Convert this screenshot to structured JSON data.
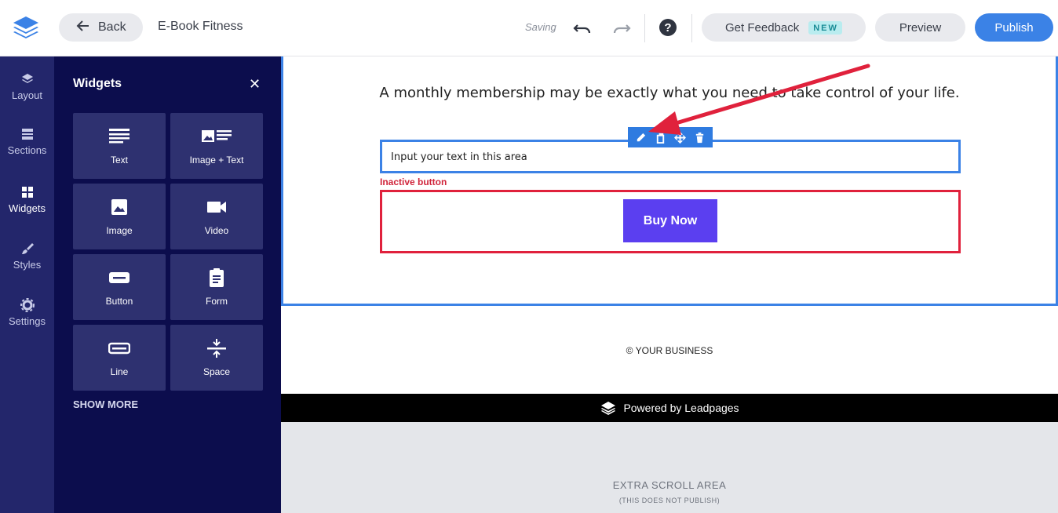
{
  "topbar": {
    "back_label": "Back",
    "page_name": "E-Book Fitness",
    "status": "Saving",
    "feedback_label": "Get Feedback",
    "feedback_badge": "NEW",
    "preview_label": "Preview",
    "publish_label": "Publish"
  },
  "rail": {
    "items": [
      {
        "label": "Layout",
        "icon": "layers-icon"
      },
      {
        "label": "Sections",
        "icon": "sections-icon"
      },
      {
        "label": "Widgets",
        "icon": "widgets-icon",
        "active": true
      },
      {
        "label": "Styles",
        "icon": "brush-icon"
      },
      {
        "label": "Settings",
        "icon": "gear-icon"
      }
    ]
  },
  "panel": {
    "title": "Widgets",
    "tiles": [
      {
        "label": "Text",
        "icon": "text-icon"
      },
      {
        "label": "Image + Text",
        "icon": "image-text-icon"
      },
      {
        "label": "Image",
        "icon": "image-icon"
      },
      {
        "label": "Video",
        "icon": "video-icon"
      },
      {
        "label": "Button",
        "icon": "button-icon"
      },
      {
        "label": "Form",
        "icon": "form-icon"
      },
      {
        "label": "Line",
        "icon": "line-icon"
      },
      {
        "label": "Space",
        "icon": "space-icon"
      }
    ],
    "show_more": "SHOW MORE"
  },
  "canvas": {
    "headline": "A monthly membership may be exactly what you need to take control of your life.",
    "text_widget": "Input your text in this area",
    "inactive_label": "Inactive button",
    "buy_button": "Buy Now",
    "footer": "© YOUR BUSINESS",
    "powered_by": "Powered by Leadpages",
    "extra_title": "EXTRA SCROLL AREA",
    "extra_sub": "(THIS DOES NOT PUBLISH)"
  },
  "colors": {
    "accent": "#3b82e6",
    "rail": "#23266b",
    "panel": "#0c0d4d",
    "tile": "#2e3170",
    "buy": "#5b3ff0",
    "annotation": "#e0213c"
  }
}
